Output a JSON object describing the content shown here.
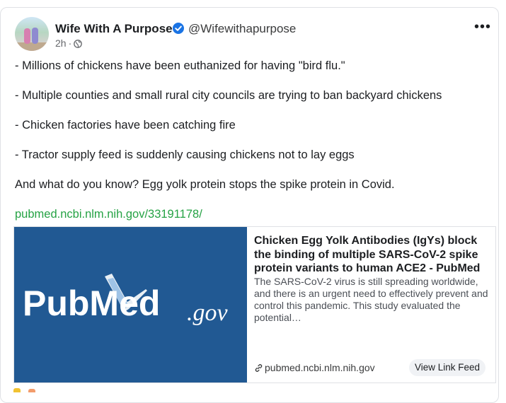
{
  "post": {
    "author_name": "Wife With A Purpose",
    "handle": "@Wifewithapurpose",
    "time": "2h",
    "separator": "·",
    "verified_icon": "verified-check-icon",
    "privacy_icon": "globe-icon",
    "more_icon": "more-dots-icon",
    "more_label": "•••",
    "lines": [
      "- Millions of chickens have been euthanized for having \"bird flu.\"",
      "- Multiple counties and small rural city councils are trying to ban backyard chickens",
      "- Chicken factories have been catching fire",
      "- Tractor supply feed is suddenly causing chickens not to lay eggs",
      "And what do you know? Egg yolk protein stops the spike protein in Covid."
    ],
    "link": "pubmed.ncbi.nlm.nih.gov/33191178/"
  },
  "preview": {
    "logo_main": "PubMed",
    "logo_suffix": ".gov",
    "title": "Chicken Egg Yolk Antibodies (IgYs) block the binding of multiple SARS-CoV-2 spike protein variants to human ACE2 - PubMed",
    "description": "The SARS-CoV-2 virus is still spreading worldwide, and there is an urgent need to effectively prevent and control this pandemic. This study evaluated the potential…",
    "domain": "pubmed.ncbi.nlm.nih.gov",
    "domain_icon": "link-icon",
    "button": "View Link Feed"
  },
  "colors": {
    "link_green": "#25a244",
    "pubmed_blue": "#215993",
    "verified_blue": "#1b74e4"
  }
}
